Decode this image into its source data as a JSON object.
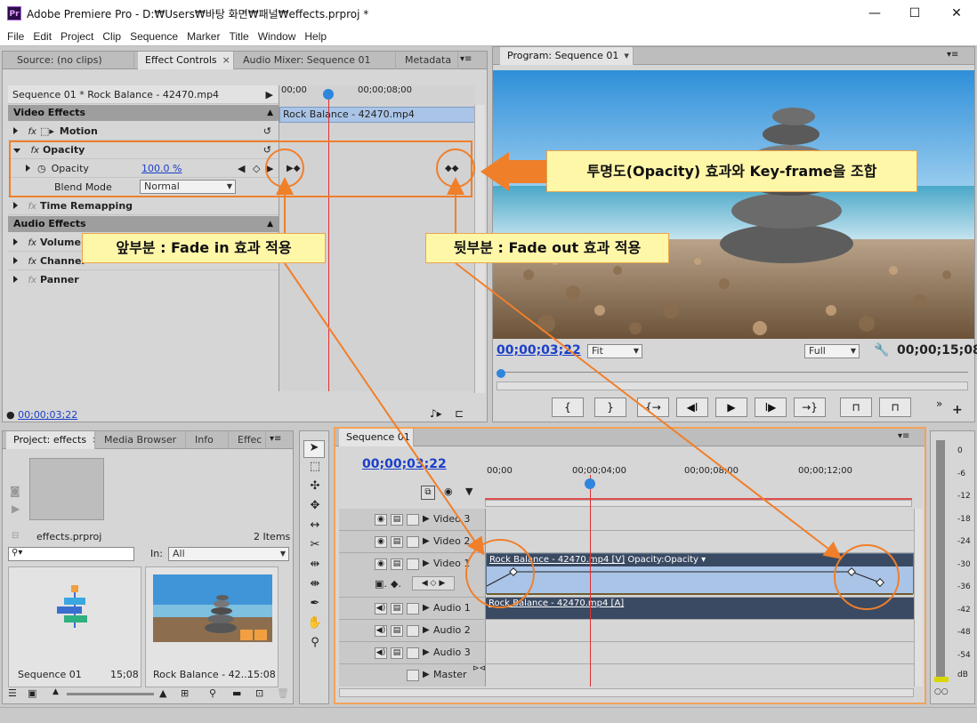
{
  "window": {
    "title": "Adobe Premiere Pro - D:₩Users₩바탕 화면₩패널₩effects.prproj *",
    "logo": "Pr",
    "minimize": "—",
    "maximize": "☐",
    "close": "✕"
  },
  "menu": [
    "File",
    "Edit",
    "Project",
    "Clip",
    "Sequence",
    "Marker",
    "Title",
    "Window",
    "Help"
  ],
  "source_panel": {
    "tabs": [
      "Source: (no clips)",
      "Effect Controls",
      "Audio Mixer: Sequence 01",
      "Metadata"
    ],
    "header": "Sequence 01 * Rock Balance - 42470.mp4",
    "ruler": [
      "00;00",
      "00;00;08;00"
    ],
    "clip_bar": "Rock Balance - 42470.mp4",
    "video_effects": "Video Effects",
    "motion": "Motion",
    "opacity": "Opacity",
    "opacity_param": "Opacity",
    "opacity_value": "100.0 %",
    "blend_mode": "Blend Mode",
    "blend_value": "Normal",
    "time_remapping": "Time Remapping",
    "audio_effects": "Audio Effects",
    "volume": "Volume",
    "channel": "Channel",
    "panner": "Panner",
    "timecode": "00;00;03;22"
  },
  "program_panel": {
    "tab": "Program: Sequence 01",
    "timecode": "00;00;03;22",
    "fit": "Fit",
    "quality": "Full",
    "duration": "00;00;15;08",
    "buttons": [
      "{",
      "}",
      "{→",
      "◀I",
      "▶",
      "I▶",
      "→}",
      "⊓",
      "⊓"
    ]
  },
  "project_panel": {
    "tabs": [
      "Project: effects",
      "Media Browser",
      "Info",
      "Effec"
    ],
    "file": "effects.prproj",
    "items_count": "2 Items",
    "in_label": "In:",
    "in_value": "All",
    "items": [
      {
        "name": "Sequence 01",
        "duration": "15;08"
      },
      {
        "name": "Rock Balance - 42...",
        "duration": "15:08"
      }
    ]
  },
  "timeline_panel": {
    "tab": "Sequence 01",
    "timecode": "00;00;03;22",
    "ruler": [
      "00;00",
      "00;00;04;00",
      "00;00;08;00",
      "00;00;12;00"
    ],
    "tracks": [
      "Video 3",
      "Video 2",
      "Video 1",
      "Audio 1",
      "Audio 2",
      "Audio 3",
      "Master"
    ],
    "video_clip": "Rock Balance - 42470.mp4 [V]",
    "video_fx": "Opacity:Opacity",
    "audio_clip": "Rock Balance - 42470.mp4 [A]"
  },
  "meter": {
    "labels": [
      "0",
      "-6",
      "-12",
      "-18",
      "-24",
      "-30",
      "-36",
      "-42",
      "-48",
      "-54",
      "dB"
    ]
  },
  "callouts": {
    "main": "투명도(Opacity) 효과와 Key-frame을 조합",
    "fade_in": "앞부분 : Fade in 효과 적용",
    "fade_out": "뒷부분 : Fade out 효과 적용"
  },
  "colors": {
    "accent_orange": "#f07f2a",
    "callout_bg": "#fff7a8",
    "playhead": "#e03030",
    "clip_blue": "#a9c4e6"
  }
}
